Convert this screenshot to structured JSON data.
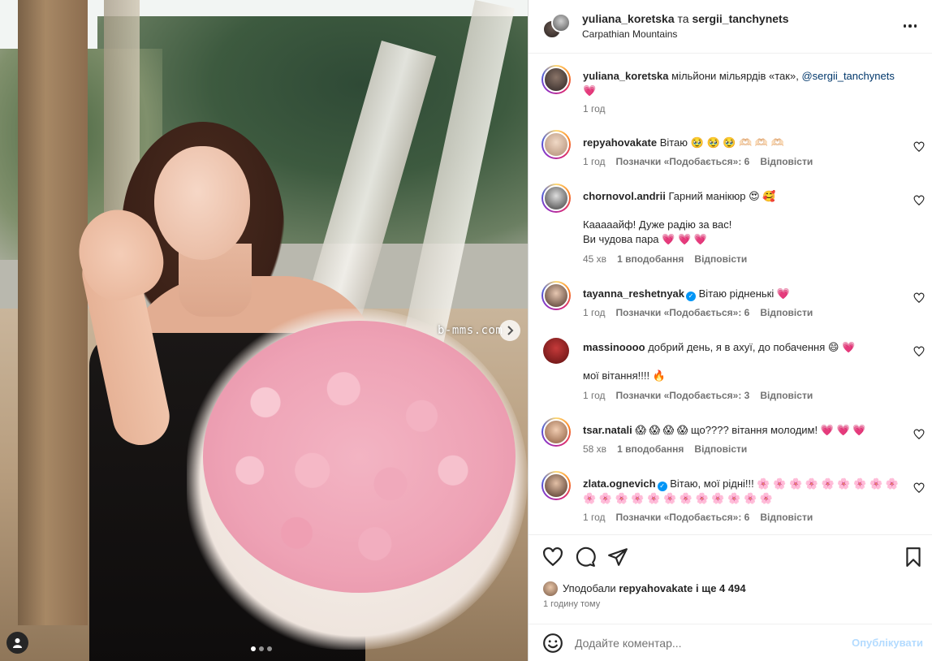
{
  "header": {
    "user1": "yuliana_koretska",
    "separator": "та",
    "user2": "sergii_tanchynets",
    "location": "Carpathian Mountains"
  },
  "caption": {
    "user": "yuliana_koretska",
    "text": "мільйони мільярдів «так»,",
    "mention": "@sergii_tanchynets",
    "emoji": "💗",
    "time": "1 год"
  },
  "comments": [
    {
      "user": "repyahovakate",
      "verified": false,
      "text": "Вітаю 🥹 🥹 🥹 🫶🏻 🫶🏻 🫶🏻",
      "extra": "",
      "time": "1 год",
      "likes": "Позначки «Подобається»: 6",
      "reply": "Відповісти"
    },
    {
      "user": "chornovol.andrii",
      "verified": false,
      "text": "Гарний манікюр 😍 🥰",
      "extra": "Кааааайф! Дуже радію за вас!\nВи чудова пара 💗 💗 💗",
      "time": "45 хв",
      "likes": "1 вподобання",
      "reply": "Відповісти"
    },
    {
      "user": "tayanna_reshetnyak",
      "verified": true,
      "text": "Вітаю рідненькі 💗",
      "extra": "",
      "time": "1 год",
      "likes": "Позначки «Подобається»: 6",
      "reply": "Відповісти"
    },
    {
      "user": "massinoooo",
      "verified": false,
      "text": "добрий день, я в ахуї, до побачення 😄 💗",
      "extra": "мої вітання!!!! 🔥",
      "time": "1 год",
      "likes": "Позначки «Подобається»: 3",
      "reply": "Відповісти"
    },
    {
      "user": "tsar.natali",
      "verified": false,
      "text": "😱 😱 😱 😱 що???? вітання молодим! 💗 💗 💗",
      "extra": "",
      "time": "58 хв",
      "likes": "1 вподобання",
      "reply": "Відповісти"
    },
    {
      "user": "zlata.ognevich",
      "verified": true,
      "text": "Вітаю, мої рідні!!! 🌸 🌸 🌸 🌸 🌸 🌸 🌸 🌸 🌸 🌸 🌸 🌸 🌸 🌸 🌸 🌸 🌸 🌸 🌸 🌸 🌸",
      "extra": "",
      "time": "1 год",
      "likes": "Позначки «Подобається»: 6",
      "reply": "Відповісти"
    }
  ],
  "likes": {
    "prefix": "Уподобали",
    "user": "repyahovakate",
    "suffix": "і ще 4 494",
    "when": "1 годину тому"
  },
  "composer": {
    "placeholder": "Додайте коментар...",
    "publish": "Опублікувати"
  },
  "photo": {
    "watermark": "b-mms.com",
    "slide_index": 1,
    "slide_count": 3
  },
  "icons": {
    "like": "heart-icon",
    "comment": "comment-icon",
    "share": "share-icon",
    "save": "bookmark-icon",
    "more": "more-icon",
    "emoji": "emoji-icon",
    "next": "chevron-right-icon",
    "tags": "user-tag-icon"
  }
}
